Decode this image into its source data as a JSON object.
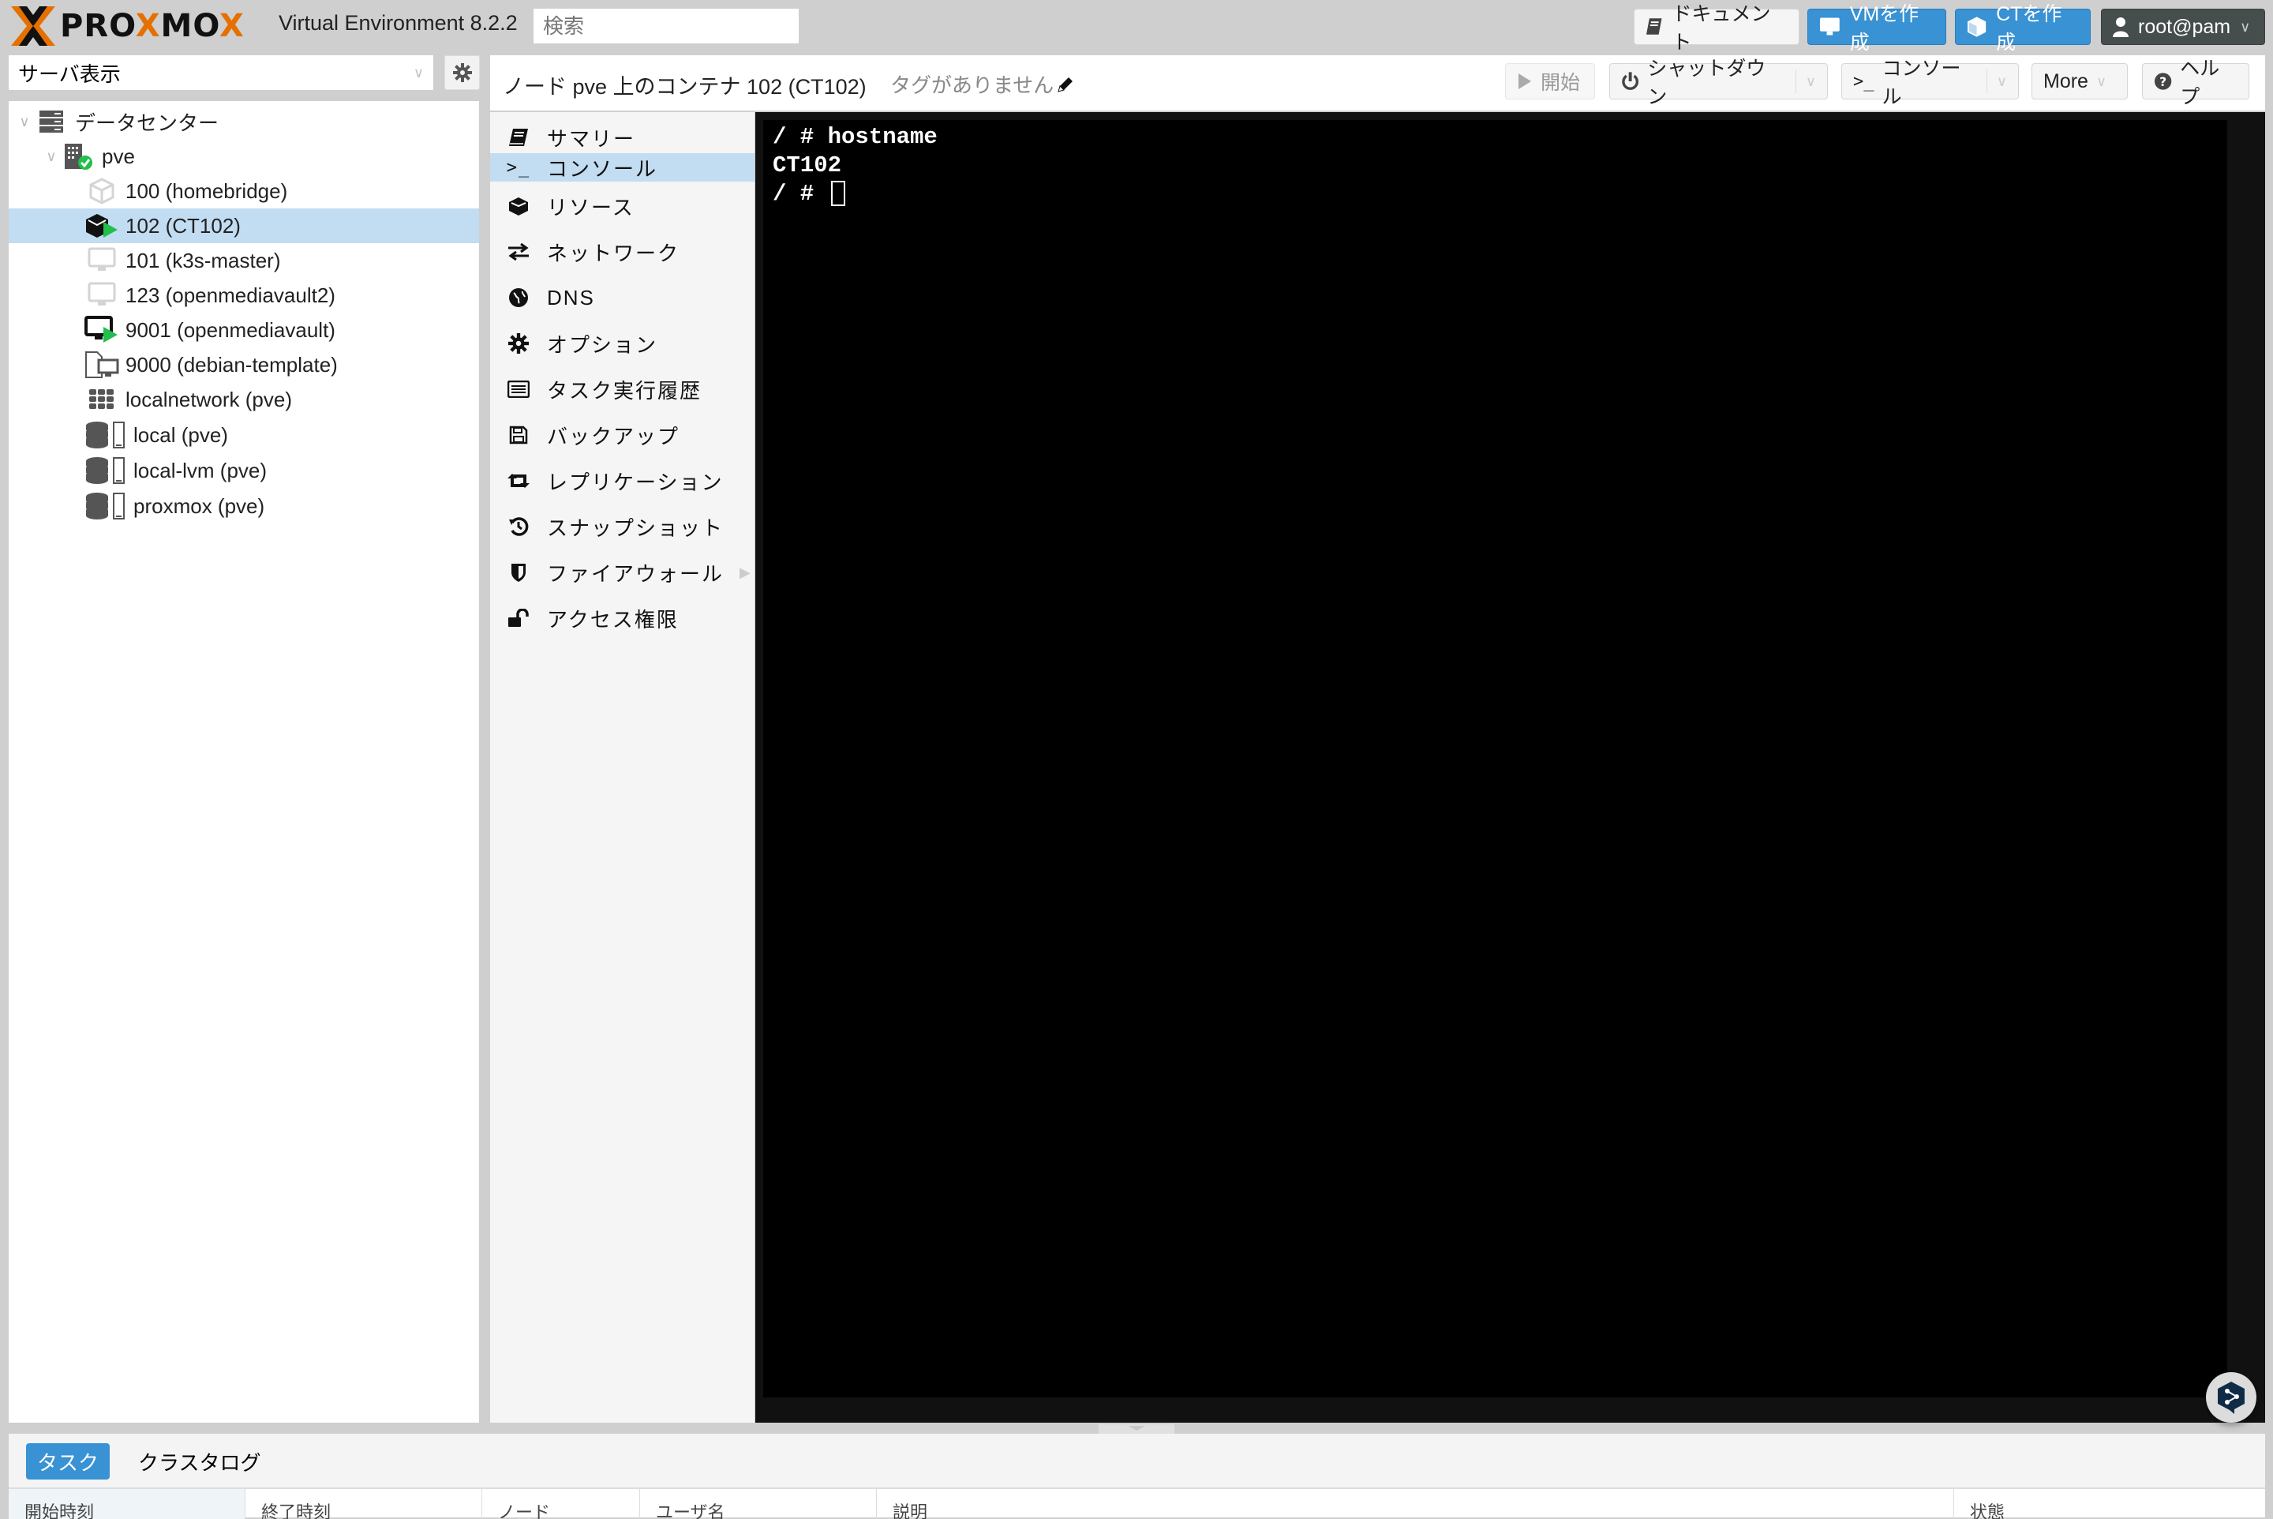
{
  "header": {
    "brand_prefix": "PRO",
    "brand_x1": "X",
    "brand_mid": "MO",
    "brand_x2": "X",
    "version": "Virtual Environment 8.2.2",
    "search_placeholder": "検索",
    "buttons": {
      "docs": "ドキュメント",
      "create_vm": "VMを作成",
      "create_ct": "CTを作成",
      "user": "root@pam"
    }
  },
  "sidebar": {
    "view_selector": "サーバ表示",
    "tree": [
      {
        "label": "データセンター",
        "icon": "datacenter-icon",
        "level": 0
      },
      {
        "label": "pve",
        "icon": "node-online-icon",
        "level": 1
      },
      {
        "label": "100 (homebridge)",
        "icon": "container-stopped-icon",
        "level": 2
      },
      {
        "label": "102 (CT102)",
        "icon": "container-running-icon",
        "level": 2,
        "selected": true
      },
      {
        "label": "101 (k3s-master)",
        "icon": "vm-stopped-icon",
        "level": 2
      },
      {
        "label": "123 (openmediavault2)",
        "icon": "vm-stopped-icon",
        "level": 2
      },
      {
        "label": "9001 (openmediavault)",
        "icon": "vm-running-icon",
        "level": 2
      },
      {
        "label": "9000 (debian-template)",
        "icon": "template-icon",
        "level": 2
      },
      {
        "label": "localnetwork (pve)",
        "icon": "sdn-zone-icon",
        "level": 2
      },
      {
        "label": "local (pve)",
        "icon": "storage-icon",
        "level": 2
      },
      {
        "label": "local-lvm (pve)",
        "icon": "storage-icon",
        "level": 2
      },
      {
        "label": "proxmox (pve)",
        "icon": "storage-icon",
        "level": 2
      }
    ]
  },
  "content": {
    "title": "ノード pve 上のコンテナ 102 (CT102)",
    "tags": "タグがありません",
    "toolbar": {
      "start": "開始",
      "shutdown": "シャットダウン",
      "console": "コンソール",
      "more": "More",
      "help": "ヘルプ"
    },
    "menu": [
      {
        "label": "サマリー",
        "icon": "book-icon"
      },
      {
        "label": "コンソール",
        "icon": "terminal-icon",
        "selected": true
      },
      {
        "label": "リソース",
        "icon": "cube-icon"
      },
      {
        "label": "ネットワーク",
        "icon": "exchange-icon"
      },
      {
        "label": "DNS",
        "icon": "globe-icon"
      },
      {
        "label": "オプション",
        "icon": "gear-icon"
      },
      {
        "label": "タスク実行履歴",
        "icon": "list-icon"
      },
      {
        "label": "バックアップ",
        "icon": "floppy-icon"
      },
      {
        "label": "レプリケーション",
        "icon": "retweet-icon"
      },
      {
        "label": "スナップショット",
        "icon": "history-icon"
      },
      {
        "label": "ファイアウォール",
        "icon": "shield-icon",
        "submenu": true
      },
      {
        "label": "アクセス権限",
        "icon": "unlock-icon"
      }
    ],
    "terminal": {
      "lines": [
        "/ # hostname",
        "CT102",
        "/ # "
      ]
    }
  },
  "bottom": {
    "tabs": [
      "タスク",
      "クラスタログ"
    ],
    "columns": [
      "開始時刻",
      "終了時刻",
      "ノード",
      "ユーザ名",
      "説明",
      "状態"
    ]
  },
  "colors": {
    "accent": "#3892d4",
    "selection": "#c2dcf1",
    "brand_orange": "#e57000",
    "running_green": "#21bf4b"
  }
}
